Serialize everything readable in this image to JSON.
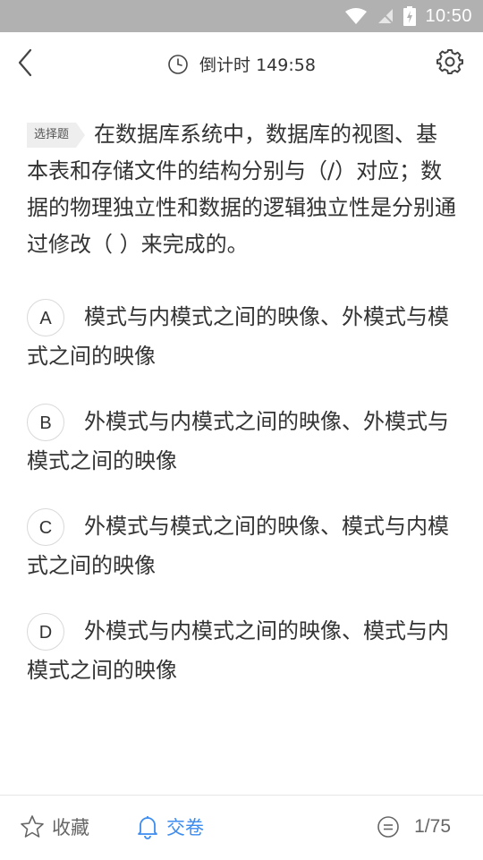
{
  "status_bar": {
    "time": "10:50"
  },
  "header": {
    "timer_label": "倒计时 149:58"
  },
  "question": {
    "type_tag": "选择题",
    "text": "在数据库系统中，数据库的视图、基本表和存储文件的结构分别与（/）对应；数据的物理独立性和数据的逻辑独立性是分别通过修改（ ）来完成的。"
  },
  "options": [
    {
      "letter": "A",
      "text": "模式与内模式之间的映像、外模式与模式之间的映像"
    },
    {
      "letter": "B",
      "text": "外模式与内模式之间的映像、外模式与模式之间的映像"
    },
    {
      "letter": "C",
      "text": "外模式与模式之间的映像、模式与内模式之间的映像"
    },
    {
      "letter": "D",
      "text": "外模式与内模式之间的映像、模式与内模式之间的映像"
    }
  ],
  "footer": {
    "favorite_label": "收藏",
    "submit_label": "交卷",
    "progress": "1/75"
  },
  "colors": {
    "accent": "#3d8cf0",
    "status_bar": "#b1b1b1"
  }
}
